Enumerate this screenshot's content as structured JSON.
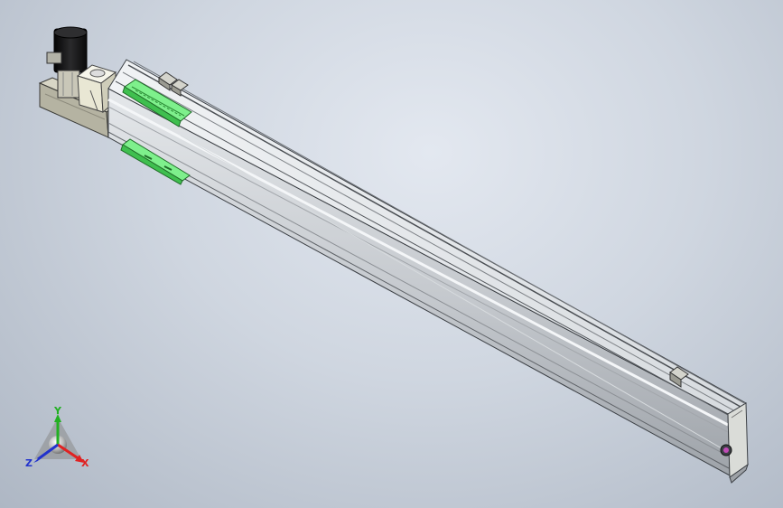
{
  "viewport": {
    "background_top": "#e3e8f0",
    "background_bottom": "#aeb7c4"
  },
  "model": {
    "rail_color": "#c9cdd2",
    "rail_top_color": "#e9ecef",
    "rail_edge_color": "#3b3f44",
    "slider_color": "#5fe36f",
    "motor_color": "#1d1d1f",
    "coupler_color": "#ecebd9",
    "bracket_color": "#b9b7a6"
  },
  "triad": {
    "x_label": "X",
    "y_label": "Y",
    "z_label": "Z",
    "x_color": "#e02222",
    "y_color": "#22b022",
    "z_color": "#2233cc"
  }
}
